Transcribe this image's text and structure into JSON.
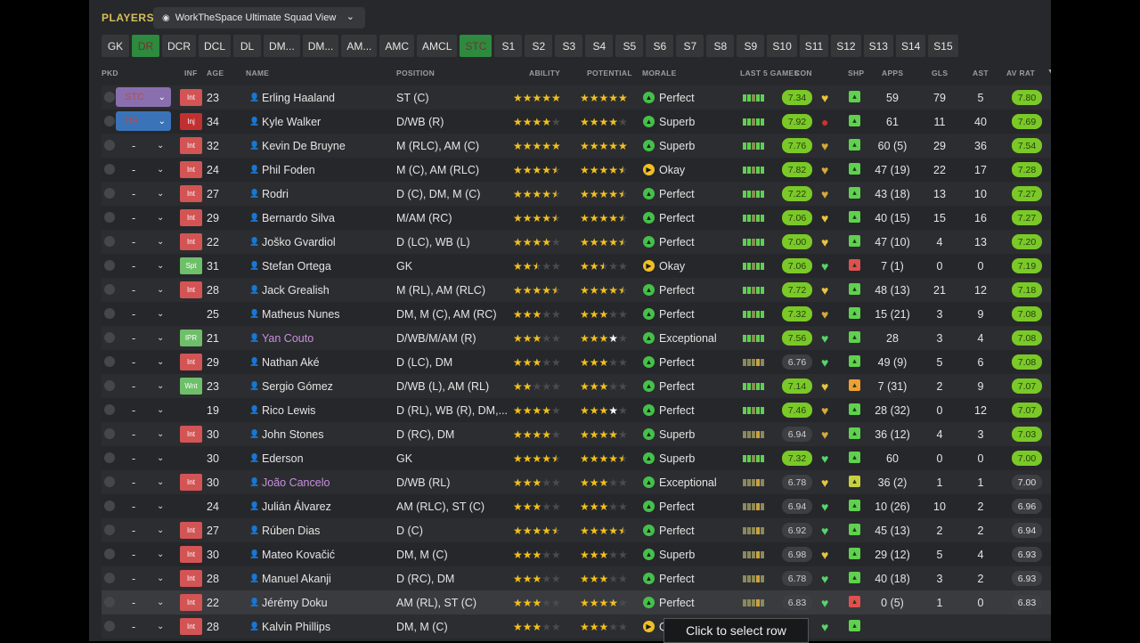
{
  "header": {
    "section": "PLAYERS",
    "view": "WorkTheSpace Ultimate Squad View"
  },
  "tabs": [
    "GK",
    "DR",
    "DCR",
    "DCL",
    "DL",
    "DM...",
    "DM...",
    "AM...",
    "AMC",
    "AMCL",
    "STC",
    "S1",
    "S2",
    "S3",
    "S4",
    "S5",
    "S6",
    "S7",
    "S8",
    "S9",
    "S10",
    "S11",
    "S12",
    "S13",
    "S14",
    "S15"
  ],
  "active_tabs": [
    "DR",
    "STC"
  ],
  "columns": {
    "pkd": "PKD",
    "inf": "INF",
    "age": "AGE",
    "name": "NAME",
    "position": "POSITION",
    "ability": "ABILITY",
    "potential": "POTENTIAL",
    "morale": "MORALE",
    "last5": "LAST 5 GAMES",
    "con": "CON",
    "shp": "SHP",
    "apps": "APPS",
    "gls": "GLS",
    "ast": "AST",
    "avrat": "AV RAT"
  },
  "colors": {
    "green": "#7ac927",
    "star": "#f2c01e",
    "purple_name": "#c98fe0",
    "heart_green": "#56d66a",
    "heart_yellow": "#e6c640"
  },
  "tooltip": "Click to select row",
  "players": [
    {
      "pkd": "STC",
      "inf": "Int",
      "age": "23",
      "name": "Erling Haaland",
      "position": "ST (C)",
      "ability": "★★★★★",
      "potential": "★★★★★",
      "morale": "Perfect",
      "morale_ic": "g",
      "form": "7.34",
      "form_green": true,
      "apps": "59",
      "gls": "79",
      "ast": "5",
      "av": "7.80",
      "av_green": true,
      "shp": "g",
      "con": "y"
    },
    {
      "pkd": "DR",
      "inf": "Inj",
      "age": "34",
      "name": "Kyle Walker",
      "position": "D/WB (R)",
      "ability": "★★★★",
      "potential": "★★★★",
      "morale": "Superb",
      "morale_ic": "g",
      "form": "7.92",
      "form_green": true,
      "apps": "61",
      "gls": "11",
      "ast": "40",
      "av": "7.69",
      "av_green": true,
      "shp": "g",
      "con": "r"
    },
    {
      "pkd": "-",
      "inf": "Int",
      "age": "32",
      "name": "Kevin De Bruyne",
      "position": "M (RLC), AM (C)",
      "ability": "★★★★★",
      "potential": "★★★★★",
      "morale": "Superb",
      "morale_ic": "g",
      "form": "7.76",
      "form_green": true,
      "apps": "60 (5)",
      "gls": "29",
      "ast": "36",
      "av": "7.54",
      "av_green": true,
      "shp": "g",
      "con": "o"
    },
    {
      "pkd": "-",
      "inf": "Int",
      "age": "24",
      "name": "Phil Foden",
      "position": "M (C), AM (RLC)",
      "ability": "★★★★½",
      "potential": "★★★★½",
      "morale": "Okay",
      "morale_ic": "y",
      "form": "7.82",
      "form_green": true,
      "apps": "47 (19)",
      "gls": "22",
      "ast": "17",
      "av": "7.28",
      "av_green": true,
      "shp": "g",
      "con": "o"
    },
    {
      "pkd": "-",
      "inf": "Int",
      "age": "27",
      "name": "Rodri",
      "position": "D (C), DM, M (C)",
      "ability": "★★★★½",
      "potential": "★★★★½",
      "morale": "Perfect",
      "morale_ic": "g",
      "form": "7.22",
      "form_green": true,
      "apps": "43 (18)",
      "gls": "13",
      "ast": "10",
      "av": "7.27",
      "av_green": true,
      "shp": "g",
      "con": "o"
    },
    {
      "pkd": "-",
      "inf": "Int",
      "age": "29",
      "name": "Bernardo Silva",
      "position": "M/AM (RC)",
      "ability": "★★★★½",
      "potential": "★★★★½",
      "morale": "Perfect",
      "morale_ic": "g",
      "form": "7.06",
      "form_green": true,
      "apps": "40 (15)",
      "gls": "15",
      "ast": "16",
      "av": "7.27",
      "av_green": true,
      "shp": "g",
      "con": "y"
    },
    {
      "pkd": "-",
      "inf": "Int",
      "age": "22",
      "name": "Joško Gvardiol",
      "position": "D (LC), WB (L)",
      "ability": "★★★★",
      "potential": "★★★★½",
      "morale": "Perfect",
      "morale_ic": "g",
      "form": "7.00",
      "form_green": true,
      "apps": "47 (10)",
      "gls": "4",
      "ast": "13",
      "av": "7.20",
      "av_green": true,
      "shp": "g",
      "con": "y"
    },
    {
      "pkd": "-",
      "inf": "Spt",
      "age": "31",
      "name": "Stefan Ortega",
      "position": "GK",
      "ability": "★★½",
      "potential": "★★½",
      "morale": "Okay",
      "morale_ic": "y",
      "form": "7.06",
      "form_green": true,
      "apps": "7 (1)",
      "gls": "0",
      "ast": "0",
      "av": "7.19",
      "av_green": true,
      "shp": "r",
      "con": "g"
    },
    {
      "pkd": "-",
      "inf": "Int",
      "age": "28",
      "name": "Jack Grealish",
      "position": "M (RL), AM (RLC)",
      "ability": "★★★★½",
      "potential": "★★★★½",
      "morale": "Perfect",
      "morale_ic": "g",
      "form": "7.72",
      "form_green": true,
      "apps": "48 (13)",
      "gls": "21",
      "ast": "12",
      "av": "7.18",
      "av_green": true,
      "shp": "g",
      "con": "y"
    },
    {
      "pkd": "-",
      "inf": "",
      "age": "25",
      "name": "Matheus Nunes",
      "position": "DM, M (C), AM (RC)",
      "ability": "★★★",
      "potential": "★★★",
      "morale": "Perfect",
      "morale_ic": "g",
      "form": "7.32",
      "form_green": true,
      "apps": "15 (21)",
      "gls": "3",
      "ast": "9",
      "av": "7.08",
      "av_green": true,
      "shp": "g",
      "con": "o"
    },
    {
      "pkd": "-",
      "inf": "IPR",
      "age": "21",
      "name": "Yan Couto",
      "position": "D/WB/M/AM (R)",
      "ability": "★★★",
      "potential": "★★★★",
      "morale": "Exceptional",
      "morale_ic": "g",
      "form": "7.56",
      "form_green": true,
      "apps": "28",
      "gls": "3",
      "ast": "4",
      "av": "7.08",
      "av_green": true,
      "shp": "g",
      "con": "g",
      "purple": true,
      "potw": true
    },
    {
      "pkd": "-",
      "inf": "Int",
      "age": "29",
      "name": "Nathan Aké",
      "position": "D (LC), DM",
      "ability": "★★★",
      "potential": "★★★",
      "morale": "Perfect",
      "morale_ic": "g",
      "form": "6.76",
      "form_green": false,
      "apps": "49 (9)",
      "gls": "5",
      "ast": "6",
      "av": "7.08",
      "av_green": true,
      "shp": "g",
      "con": "g"
    },
    {
      "pkd": "-",
      "inf": "Wnt",
      "age": "23",
      "name": "Sergio Gómez",
      "position": "D/WB (L), AM (RL)",
      "ability": "★★",
      "potential": "★★★",
      "morale": "Perfect",
      "morale_ic": "g",
      "form": "7.14",
      "form_green": true,
      "apps": "7 (31)",
      "gls": "2",
      "ast": "9",
      "av": "7.07",
      "av_green": true,
      "shp": "o",
      "con": "y"
    },
    {
      "pkd": "-",
      "inf": "",
      "age": "19",
      "name": "Rico Lewis",
      "position": "D (RL), WB (R), DM,...",
      "ability": "★★★★",
      "potential": "★★★★",
      "morale": "Perfect",
      "morale_ic": "g",
      "form": "7.46",
      "form_green": true,
      "apps": "28 (32)",
      "gls": "0",
      "ast": "12",
      "av": "7.07",
      "av_green": true,
      "shp": "g",
      "con": "o",
      "potw": true
    },
    {
      "pkd": "-",
      "inf": "Int",
      "age": "30",
      "name": "John Stones",
      "position": "D (RC), DM",
      "ability": "★★★★",
      "potential": "★★★★",
      "morale": "Superb",
      "morale_ic": "g",
      "form": "6.94",
      "form_green": false,
      "apps": "36 (12)",
      "gls": "4",
      "ast": "3",
      "av": "7.03",
      "av_green": true,
      "shp": "g",
      "con": "o"
    },
    {
      "pkd": "-",
      "inf": "",
      "age": "30",
      "name": "Ederson",
      "position": "GK",
      "ability": "★★★★½",
      "potential": "★★★★½",
      "morale": "Superb",
      "morale_ic": "g",
      "form": "7.32",
      "form_green": true,
      "apps": "60",
      "gls": "0",
      "ast": "0",
      "av": "7.00",
      "av_green": true,
      "shp": "g",
      "con": "g"
    },
    {
      "pkd": "-",
      "inf": "Int",
      "age": "30",
      "name": "João Cancelo",
      "position": "D/WB (RL)",
      "ability": "★★★",
      "potential": "★★★",
      "morale": "Exceptional",
      "morale_ic": "g",
      "form": "6.78",
      "form_green": false,
      "apps": "36 (2)",
      "gls": "1",
      "ast": "1",
      "av": "7.00",
      "av_green": false,
      "shp": "y",
      "con": "y",
      "purple": true
    },
    {
      "pkd": "-",
      "inf": "",
      "age": "24",
      "name": "Julián Álvarez",
      "position": "AM (RLC), ST (C)",
      "ability": "★★★",
      "potential": "★★★",
      "morale": "Perfect",
      "morale_ic": "g",
      "form": "6.94",
      "form_green": false,
      "apps": "10 (26)",
      "gls": "10",
      "ast": "2",
      "av": "6.96",
      "av_green": false,
      "shp": "g",
      "con": "g"
    },
    {
      "pkd": "-",
      "inf": "Int",
      "age": "27",
      "name": "Rúben Dias",
      "position": "D (C)",
      "ability": "★★★★½",
      "potential": "★★★★½",
      "morale": "Perfect",
      "morale_ic": "g",
      "form": "6.92",
      "form_green": false,
      "apps": "45 (13)",
      "gls": "2",
      "ast": "2",
      "av": "6.94",
      "av_green": false,
      "shp": "g",
      "con": "g"
    },
    {
      "pkd": "-",
      "inf": "Int",
      "age": "30",
      "name": "Mateo Kovačić",
      "position": "DM, M (C)",
      "ability": "★★★",
      "potential": "★★★",
      "morale": "Superb",
      "morale_ic": "g",
      "form": "6.98",
      "form_green": false,
      "apps": "29 (12)",
      "gls": "5",
      "ast": "4",
      "av": "6.93",
      "av_green": false,
      "shp": "g",
      "con": "y"
    },
    {
      "pkd": "-",
      "inf": "Int",
      "age": "28",
      "name": "Manuel Akanji",
      "position": "D (RC), DM",
      "ability": "★★★",
      "potential": "★★★",
      "morale": "Perfect",
      "morale_ic": "g",
      "form": "6.78",
      "form_green": false,
      "apps": "40 (18)",
      "gls": "3",
      "ast": "2",
      "av": "6.93",
      "av_green": false,
      "shp": "g",
      "con": "g"
    },
    {
      "pkd": "-",
      "inf": "Int",
      "age": "22",
      "name": "Jérémy Doku",
      "position": "AM (RL), ST (C)",
      "ability": "★★★",
      "potential": "★★★★",
      "morale": "Perfect",
      "morale_ic": "g",
      "form": "6.83",
      "form_green": false,
      "apps": "0 (5)",
      "gls": "1",
      "ast": "0",
      "av": "6.83",
      "av_green": false,
      "shp": "r",
      "con": "g",
      "hl": true
    },
    {
      "pkd": "-",
      "inf": "Int",
      "age": "28",
      "name": "Kalvin Phillips",
      "position": "DM, M (C)",
      "ability": "★★★",
      "potential": "★★★",
      "morale": "Quite Good",
      "morale_ic": "y",
      "form": "",
      "form_green": false,
      "apps": "",
      "gls": "",
      "ast": "",
      "av": "",
      "av_green": false,
      "shp": "g",
      "con": "g"
    }
  ]
}
